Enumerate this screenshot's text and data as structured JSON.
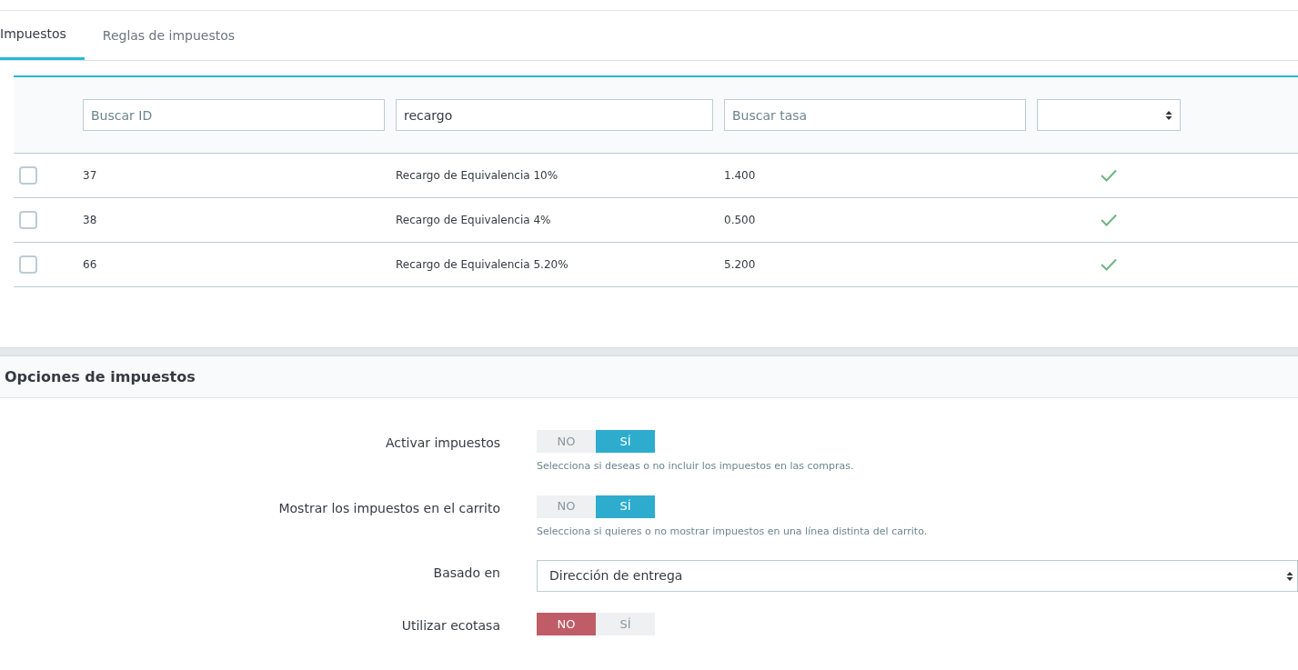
{
  "tabs": [
    {
      "label": "Impuestos",
      "selected": true
    },
    {
      "label": "Reglas de impuestos",
      "selected": false
    }
  ],
  "filters": {
    "id": {
      "placeholder": "Buscar ID"
    },
    "name": {
      "value": "recargo"
    },
    "rate": {
      "placeholder": "Buscar tasa"
    }
  },
  "rows": [
    {
      "checked": false,
      "id": "37",
      "name": "Recargo de Equivalencia 10%",
      "rate": "1.400",
      "enabled": true
    },
    {
      "checked": false,
      "id": "38",
      "name": "Recargo de Equivalencia 4%",
      "rate": "0.500",
      "enabled": true
    },
    {
      "checked": false,
      "id": "66",
      "name": "Recargo de Equivalencia 5.20%",
      "rate": "5.200",
      "enabled": true
    }
  ],
  "options": {
    "title": "Opciones de impuestos",
    "fields": [
      {
        "kind": "switch",
        "label": "Activar impuestos",
        "no": "NO",
        "yes": "SÍ",
        "on": true,
        "help": "Selecciona si deseas o no incluir los impuestos en las compras."
      },
      {
        "kind": "switch",
        "label": "Mostrar los impuestos en el carrito",
        "no": "NO",
        "yes": "SÍ",
        "on": true,
        "help": "Selecciona si quieres o no mostrar impuestos en una línea distinta del carrito."
      },
      {
        "kind": "select",
        "label": "Basado en",
        "value": "Dirección de entrega"
      },
      {
        "kind": "switch",
        "label": "Utilizar ecotasa",
        "no": "NO",
        "yes": "SÍ",
        "on": false
      }
    ]
  }
}
